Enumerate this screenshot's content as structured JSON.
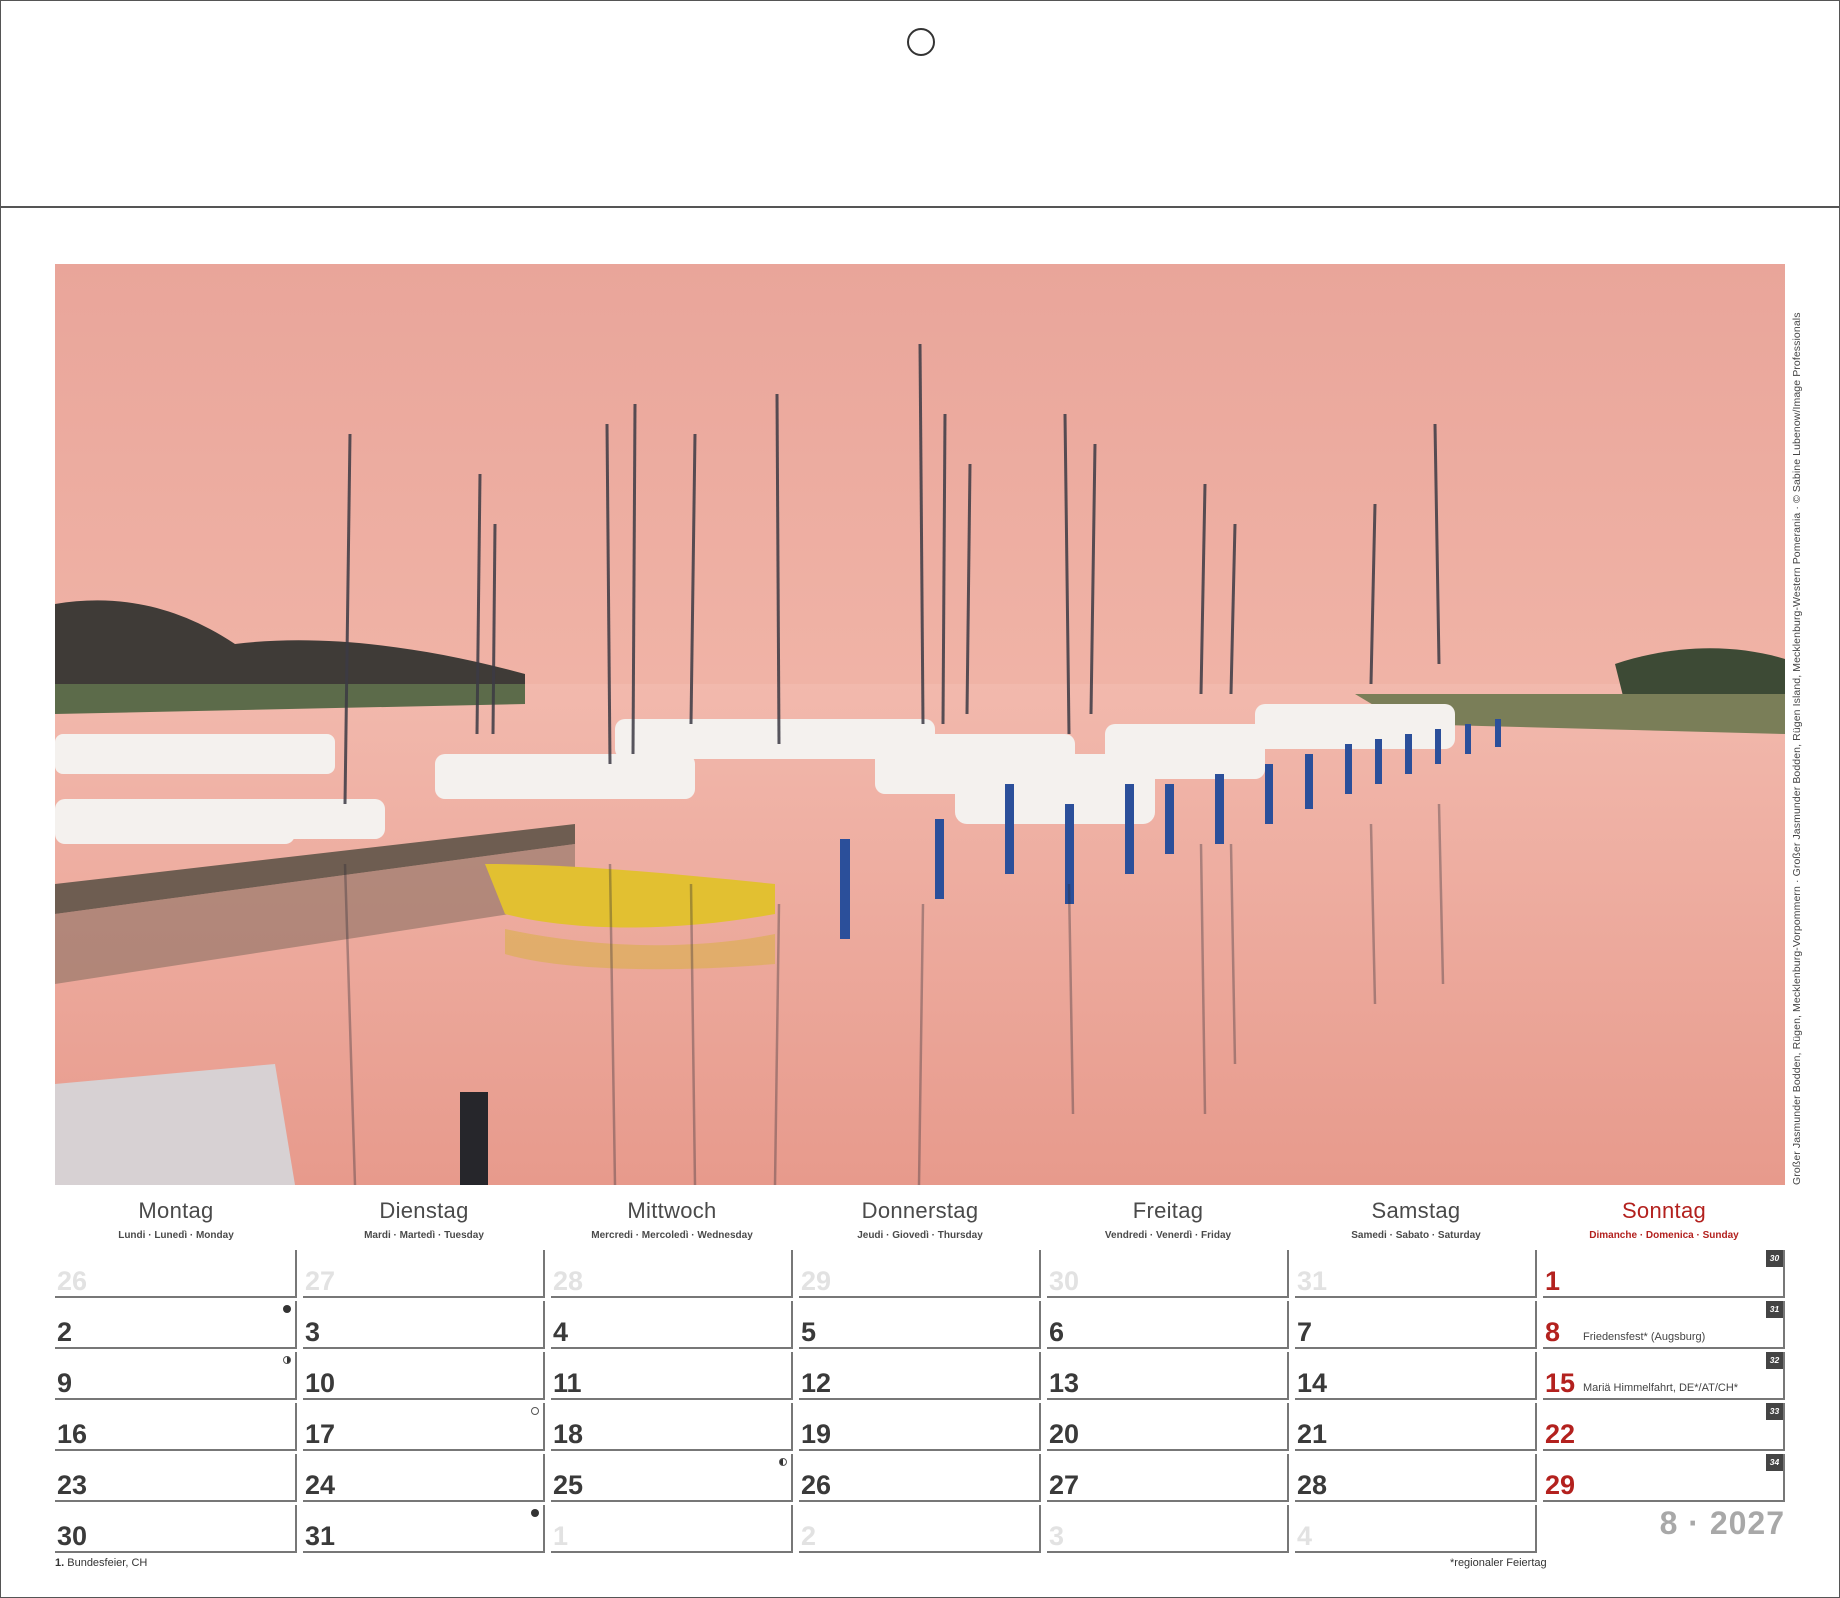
{
  "photo": {
    "description_name": "marina-sunset-photo",
    "credit": "Großer Jasmunder Bodden, Rügen, Mecklenburg-Vorpommern · Großer Jasmunder Bodden, Rügen Island, Mecklenburg-Western Pomerania · © Sabine Lubenow/Image Professionals"
  },
  "colors": {
    "accent_red": "#b3211e",
    "text": "#3a3a3a",
    "faded": "#e2e2e2"
  },
  "weekdays": [
    {
      "name": "Montag",
      "sub": "Lundi · Lunedì · Monday"
    },
    {
      "name": "Dienstag",
      "sub": "Mardi · Martedì · Tuesday"
    },
    {
      "name": "Mittwoch",
      "sub": "Mercredi · Mercoledì · Wednesday"
    },
    {
      "name": "Donnerstag",
      "sub": "Jeudi · Giovedì · Thursday"
    },
    {
      "name": "Freitag",
      "sub": "Vendredi · Venerdì · Friday"
    },
    {
      "name": "Samstag",
      "sub": "Samedi · Sabato · Saturday"
    },
    {
      "name": "Sonntag",
      "sub": "Dimanche · Domenica · Sunday"
    }
  ],
  "weeks": [
    {
      "number": "30",
      "days": [
        {
          "n": "26",
          "faded": true
        },
        {
          "n": "27",
          "faded": true
        },
        {
          "n": "28",
          "faded": true
        },
        {
          "n": "29",
          "faded": true
        },
        {
          "n": "30",
          "faded": true
        },
        {
          "n": "31",
          "faded": true
        },
        {
          "n": "1",
          "red": true
        }
      ]
    },
    {
      "number": "31",
      "days": [
        {
          "n": "2",
          "moon": "new"
        },
        {
          "n": "3"
        },
        {
          "n": "4"
        },
        {
          "n": "5"
        },
        {
          "n": "6"
        },
        {
          "n": "7"
        },
        {
          "n": "8",
          "red": true,
          "holiday": "Friedensfest* (Augsburg)"
        }
      ]
    },
    {
      "number": "32",
      "days": [
        {
          "n": "9",
          "moon": "first"
        },
        {
          "n": "10"
        },
        {
          "n": "11"
        },
        {
          "n": "12"
        },
        {
          "n": "13"
        },
        {
          "n": "14"
        },
        {
          "n": "15",
          "red": true,
          "holiday": "Mariä Himmelfahrt, DE*/AT/CH*"
        }
      ]
    },
    {
      "number": "33",
      "days": [
        {
          "n": "16"
        },
        {
          "n": "17",
          "moon": "full"
        },
        {
          "n": "18"
        },
        {
          "n": "19"
        },
        {
          "n": "20"
        },
        {
          "n": "21"
        },
        {
          "n": "22",
          "red": true
        }
      ]
    },
    {
      "number": "34",
      "days": [
        {
          "n": "23"
        },
        {
          "n": "24"
        },
        {
          "n": "25",
          "moon": "last"
        },
        {
          "n": "26"
        },
        {
          "n": "27"
        },
        {
          "n": "28"
        },
        {
          "n": "29",
          "red": true
        }
      ]
    },
    {
      "number": "",
      "days": [
        {
          "n": "30"
        },
        {
          "n": "31",
          "moon": "new"
        },
        {
          "n": "1",
          "faded": true
        },
        {
          "n": "2",
          "faded": true
        },
        {
          "n": "3",
          "faded": true
        },
        {
          "n": "4",
          "faded": true
        }
      ]
    }
  ],
  "month_year": "8 · 2027",
  "footnote_left_bold": "1.",
  "footnote_left": " Bundesfeier, CH",
  "footnote_right": "*regionaler Feiertag"
}
